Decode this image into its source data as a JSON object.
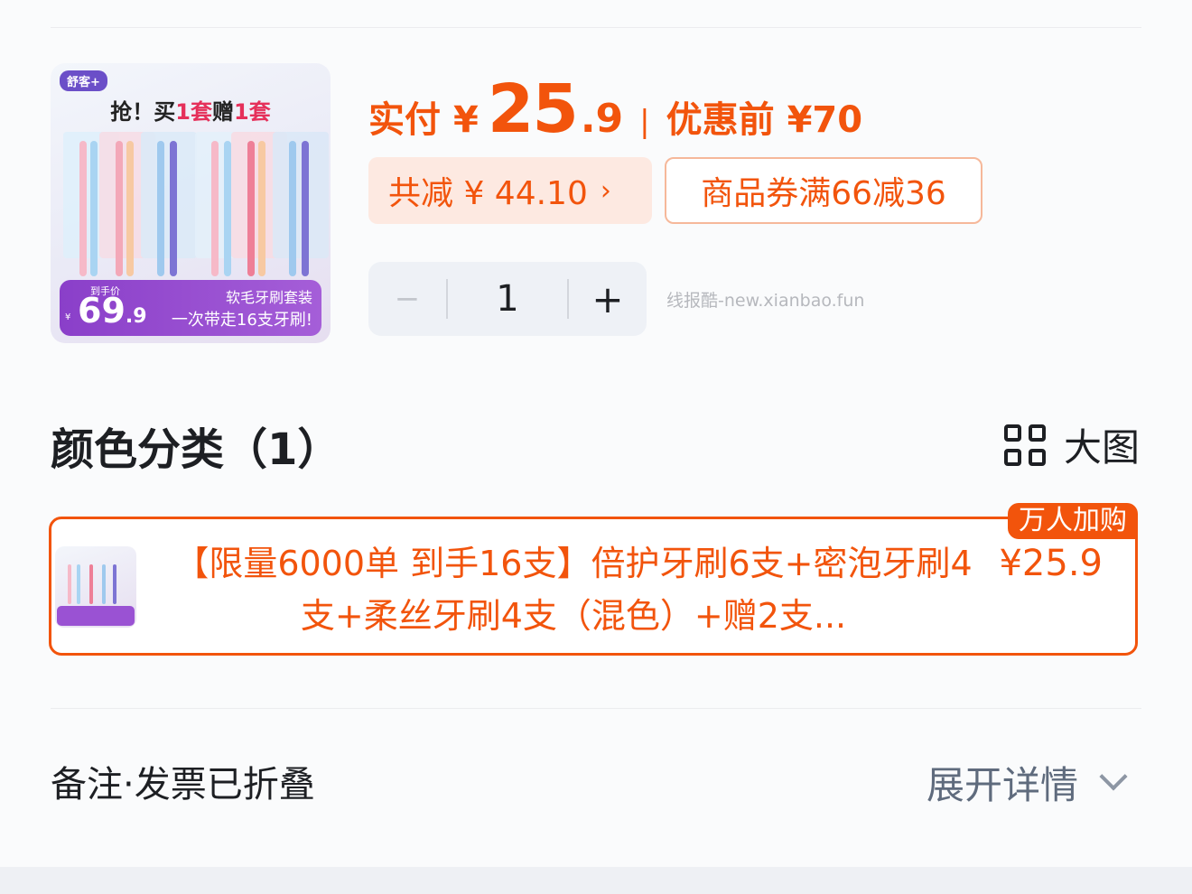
{
  "product_thumb": {
    "brand": "舒客+",
    "slogan_prefix": "抢！买",
    "slogan_buy": "1套",
    "slogan_mid": "赠",
    "slogan_get": "1套",
    "promo_label": "到手价",
    "promo_currency": "¥",
    "promo_int": "69",
    "promo_dec": ".9",
    "promo_desc1": "软毛牙刷套装",
    "promo_desc2": "一次带走16支牙刷!"
  },
  "price": {
    "paid_label": "实付",
    "currency": "¥",
    "paid_int": "25",
    "paid_dec": ".9",
    "separator": "|",
    "before_label": "优惠前 ¥70"
  },
  "discount": {
    "label": "共减 ¥ 44.10",
    "chevron": "›"
  },
  "coupon": {
    "label": "商品券满66减36"
  },
  "stepper": {
    "minus": "−",
    "quantity": "1",
    "plus": "+"
  },
  "watermark": "线报酷-new.xianbao.fun",
  "color_section": {
    "title": "颜色分类（1）",
    "view_label": "大图"
  },
  "variant": {
    "badge": "万人加购",
    "title": "【限量6000单 到手16支】倍护牙刷6支+密泡牙刷4支+柔丝牙刷4支（混色）+赠2支...",
    "price": "¥25.9"
  },
  "remark": {
    "label": "备注·发票已折叠",
    "expand_label": "展开详情"
  },
  "colors": {
    "accent": "#f2540c",
    "discount_bg": "#fde9e1",
    "coupon_border": "#f6b89a",
    "promo_purple": "#8a3fc9"
  }
}
